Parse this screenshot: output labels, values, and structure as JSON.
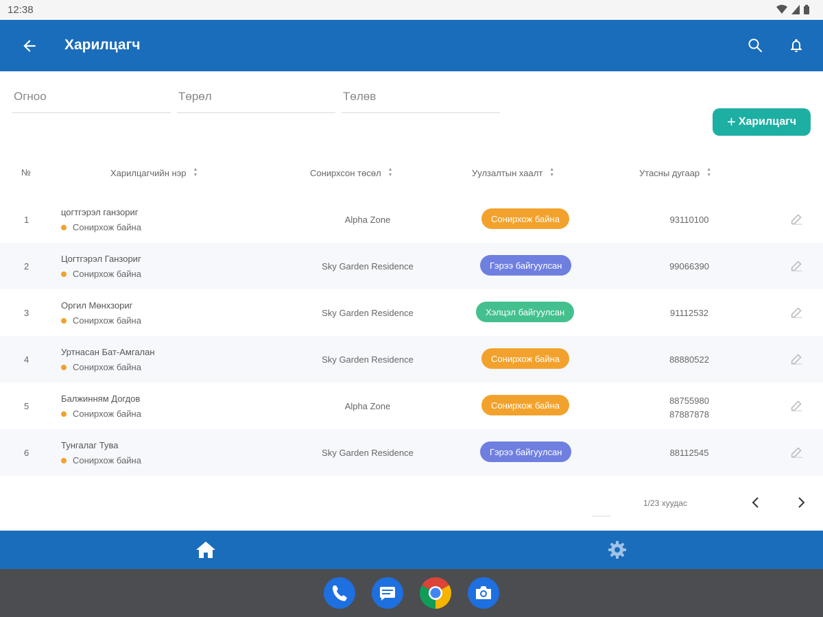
{
  "status_bar": {
    "time": "12:38"
  },
  "app_bar": {
    "title": "Харилцагч"
  },
  "filters": {
    "name_placeholder": "Огноо",
    "type_placeholder": "Төрөл",
    "status_placeholder": "Төлөв"
  },
  "add_button": {
    "label": "Харилцагч"
  },
  "table": {
    "headers": {
      "num": "№",
      "name": "Харилцагчийн нэр",
      "project": "Сонирхсон төсөл",
      "meeting": "Уулзалтын хаалт",
      "phone": "Утасны дугаар"
    },
    "rows": [
      {
        "num": "1",
        "name": "цогтгэрэл ганзориг",
        "status": "Сонирхож байна",
        "project": "Alpha Zone",
        "badge": "Сонирхож байна",
        "phone1": "93110100",
        "phone2": ""
      },
      {
        "num": "2",
        "name": "Цогтгэрэл Ганзориг",
        "status": "Сонирхож байна",
        "project": "Sky Garden Residence",
        "badge": "Гэрээ байгуулсан",
        "phone1": "99066390",
        "phone2": ""
      },
      {
        "num": "3",
        "name": "Оргил Мөнхзориг",
        "status": "Сонирхож байна",
        "project": "Sky Garden Residence",
        "badge": "Хэлцэл байгуулсан",
        "phone1": "91112532",
        "phone2": ""
      },
      {
        "num": "4",
        "name": "Уртнасан Бат-Амгалан",
        "status": "Сонирхож байна",
        "project": "Sky Garden Residence",
        "badge": "Сонирхож байна",
        "phone1": "88880522",
        "phone2": ""
      },
      {
        "num": "5",
        "name": "Балжинням Догдов",
        "status": "Сонирхож байна",
        "project": "Alpha Zone",
        "badge": "Сонирхож байна",
        "phone1": "88755980",
        "phone2": "87887878"
      },
      {
        "num": "6",
        "name": "Тунгалаг Тува",
        "status": "Сонирхож байна",
        "project": "Sky Garden Residence",
        "badge": "Гэрээ байгуулсан",
        "phone1": "88112545",
        "phone2": ""
      }
    ]
  },
  "pagination": {
    "label": "1/23 хуудас"
  },
  "colors": {
    "primary": "#1a6dba",
    "accent": "#1eafa3",
    "badge_interested": "#f2a22c",
    "badge_contract": "#6f7fe0",
    "badge_deal": "#43c08e",
    "dot": "#f2a22c"
  },
  "icons": {
    "back": "arrow-left-icon",
    "search": "search-icon",
    "notifications": "bell-icon",
    "edit": "pencil-icon",
    "home": "home-icon",
    "settings": "gear-icon",
    "dock": [
      "phone-icon",
      "messages-icon",
      "chrome-icon",
      "camera-icon"
    ]
  }
}
